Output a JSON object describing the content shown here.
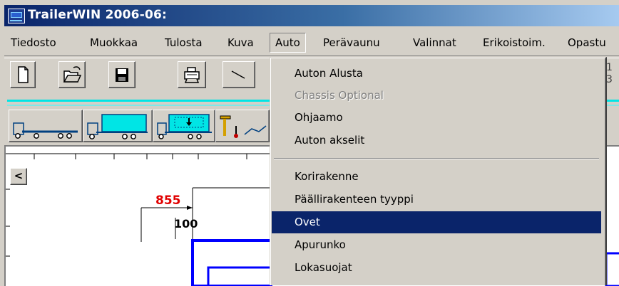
{
  "window": {
    "title": "TrailerWIN 2006-06:"
  },
  "menubar": {
    "items": [
      {
        "label": "Tiedosto"
      },
      {
        "label": "Muokkaa"
      },
      {
        "label": "Tulosta"
      },
      {
        "label": "Kuva"
      },
      {
        "label": "Auto"
      },
      {
        "label": "Perävaunu"
      },
      {
        "label": "Valinnat"
      },
      {
        "label": "Erikoistoim."
      },
      {
        "label": "Opastu"
      }
    ],
    "open_menu": "Auto"
  },
  "toolbar": {
    "icons": [
      "new-document-icon",
      "open-folder-icon",
      "save-disk-icon",
      "print-icon",
      "line-tool-icon"
    ],
    "cut_off_text": [
      "1",
      "3"
    ]
  },
  "vehicle_toolbar": {
    "icons": [
      "truck-trailer-icon",
      "truck-box-icon",
      "truck-box-load-icon",
      "crane-icon"
    ]
  },
  "drawing": {
    "dimension_red": "855",
    "dimension_black": "100",
    "scroll_left_label": "<"
  },
  "auto_menu": {
    "items": [
      {
        "label": "Auton Alusta",
        "state": "normal"
      },
      {
        "label": "Chassis Optional",
        "state": "disabled"
      },
      {
        "label": "Ohjaamo",
        "state": "normal"
      },
      {
        "label": "Auton akselit",
        "state": "normal"
      },
      {
        "label": "Korirakenne",
        "state": "normal"
      },
      {
        "label": "Päällirakenteen tyyppi",
        "state": "normal"
      },
      {
        "label": "Ovet",
        "state": "selected"
      },
      {
        "label": "Apurunko",
        "state": "normal"
      },
      {
        "label": "Lokasuojat",
        "state": "normal"
      }
    ]
  },
  "colors": {
    "titlebar_start": "#0a246a",
    "titlebar_end": "#a6caf0",
    "highlight": "#0a246a",
    "dimension_red": "#e00000",
    "accent_cyan": "#00e5e5",
    "drawing_blue": "#0000ff"
  }
}
